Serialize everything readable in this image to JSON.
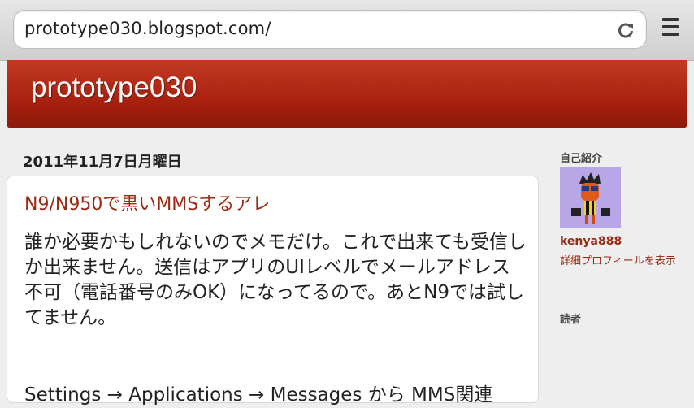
{
  "browser": {
    "url": "prototype030.blogspot.com/",
    "reload_icon": "reload-icon",
    "menu_icon": "menu-icon"
  },
  "blog": {
    "title": "prototype030"
  },
  "post": {
    "date": "2011年11月7日月曜日",
    "title": "N9/N950で黒いMMSするアレ",
    "body": "誰か必要かもしれないのでメモだけ。これで出来ても受信しか出来ません。送信はアプリのUIレベルでメールアドレス不可（電話番号のみOK）になってるので。あとN9では試してません。",
    "body_next": "Settings → Applications → Messages から MMS関連"
  },
  "sidebar": {
    "profile_heading": "自己紹介",
    "username": "kenya888",
    "profile_link": "詳細プロフィールを表示",
    "readers_heading": "読者"
  },
  "colors": {
    "header_red": "#a9200f",
    "link_red": "#9b2a14",
    "avatar_bg": "#b9a6e6"
  }
}
